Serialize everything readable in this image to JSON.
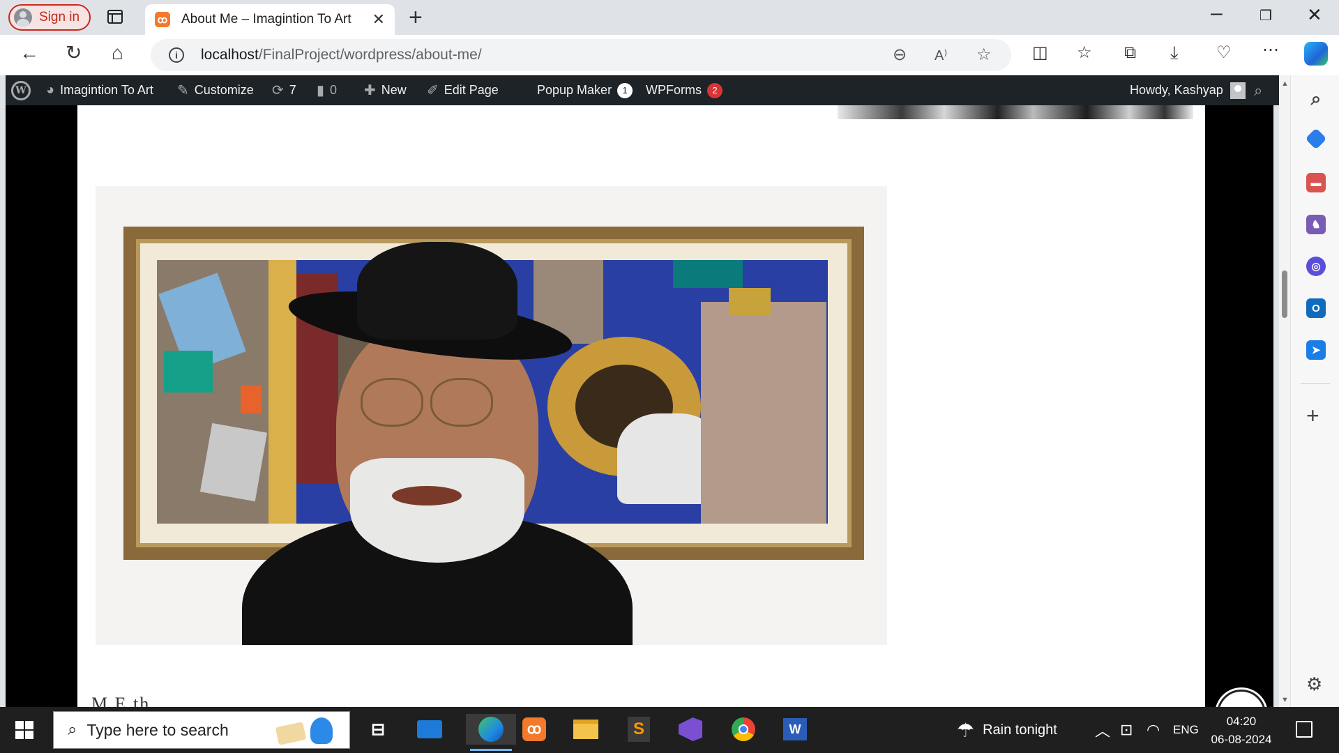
{
  "browser": {
    "sign_in_label": "Sign in",
    "tab_title": "About Me – Imagintion To Art",
    "tab_favicon": "xampp-icon",
    "address": {
      "host": "localhost",
      "path": "/FinalProject/wordpress/about-me/"
    }
  },
  "admin_bar": {
    "site_name": "Imagintion To Art",
    "customize": "Customize",
    "updates_count": "7",
    "comments_count": "0",
    "new": "New",
    "edit_page": "Edit Page",
    "popup_maker": "Popup Maker",
    "popup_maker_badge": "1",
    "wpforms": "WPForms",
    "wpforms_badge": "2",
    "howdy": "Howdy, Kashyap"
  },
  "page": {
    "image_alt": "Portrait of a bearded artist in a black hat in front of a large painting",
    "text_fragment": "M                                                                                                      E  th"
  },
  "taskbar": {
    "search_placeholder": "Type here to search",
    "weather": "Rain tonight",
    "language": "ENG",
    "time": "04:20",
    "date": "06-08-2024"
  },
  "colors": {
    "admin_bar_bg": "#1d2327",
    "badge_red": "#d63638",
    "signin_red": "#c42b1c",
    "edge_accent": "#0078d4"
  }
}
